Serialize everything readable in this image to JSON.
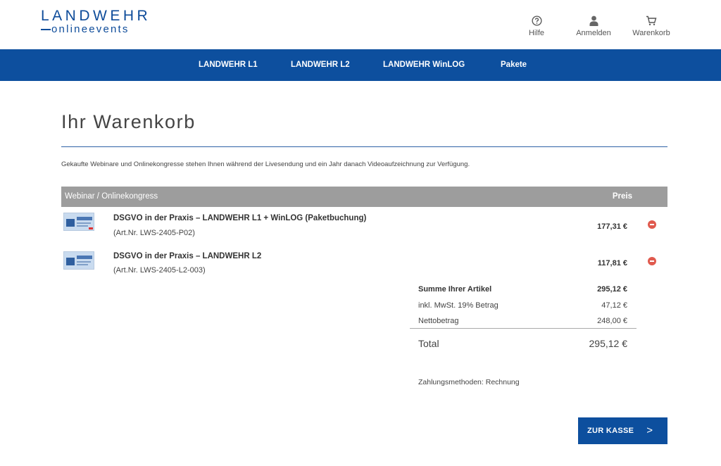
{
  "brand": {
    "main": "LANDWEHR",
    "sub": "onlineevents"
  },
  "top_actions": [
    {
      "label": "Hilfe",
      "icon": "help-icon"
    },
    {
      "label": "Anmelden",
      "icon": "user-icon"
    },
    {
      "label": "Warenkorb",
      "icon": "cart-icon"
    }
  ],
  "nav": [
    "LANDWEHR L1",
    "LANDWEHR L2",
    "LANDWEHR WinLOG",
    "Pakete"
  ],
  "page": {
    "title": "Ihr Warenkorb",
    "intro": "Gekaufte Webinare und Onlinekongresse stehen Ihnen während der Livesendung und ein Jahr danach Videoaufzeichnung zur Verfügung."
  },
  "table": {
    "col_item": "Webinar / Onlinekongress",
    "col_price": "Preis",
    "rows": [
      {
        "title": "DSGVO in der Praxis – LANDWEHR L1 + WinLOG (Paketbuchung)",
        "art": "(Art.Nr. LWS-2405-P02)",
        "price": "177,31 €"
      },
      {
        "title": "DSGVO in der Praxis – LANDWEHR L2",
        "art": "(Art.Nr. LWS-2405-L2-003)",
        "price": "117,81 €"
      }
    ]
  },
  "summary": {
    "subtotal_label": "Summe Ihrer Artikel",
    "subtotal_value": "295,12 €",
    "vat_label": "inkl. MwSt. 19% Betrag",
    "vat_value": "47,12 €",
    "net_label": "Nettobetrag",
    "net_value": "248,00 €",
    "total_label": "Total",
    "total_value": "295,12 €"
  },
  "payment": "Zahlungsmethoden: Rechnung",
  "checkout": {
    "label": "ZUR KASSE",
    "arrow": ">"
  },
  "colors": {
    "brand_blue": "#0d4f9e",
    "table_header": "#9d9d9d",
    "remove_red": "#e05a4e"
  }
}
